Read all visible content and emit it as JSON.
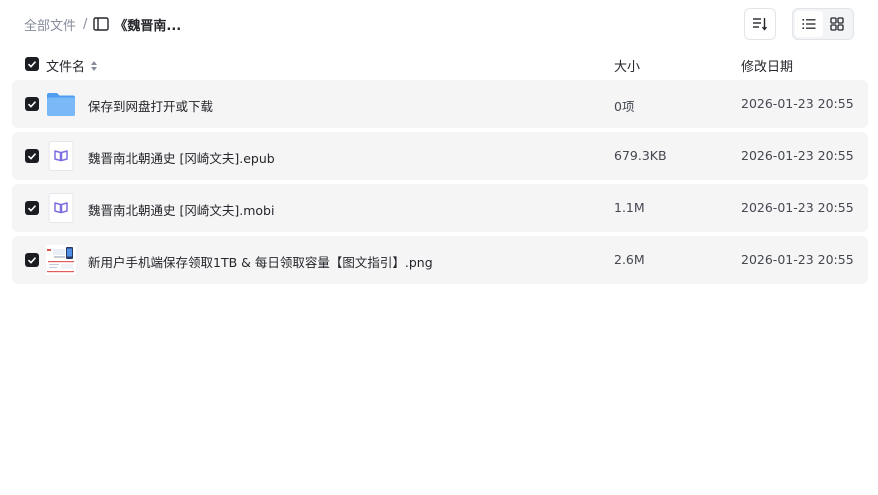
{
  "breadcrumb": {
    "root": "全部文件",
    "separator": "/",
    "current": "《魏晋南..."
  },
  "toolbar": {
    "sort_icon": "sort-icon",
    "list_view_icon": "list-view-icon",
    "grid_view_icon": "grid-view-icon"
  },
  "table": {
    "headers": {
      "name": "文件名",
      "size": "大小",
      "date": "修改日期"
    },
    "rows": [
      {
        "name": "保存到网盘打开或下载",
        "size": "0项",
        "date": "2026-01-23 20:55",
        "icon": "folder-icon"
      },
      {
        "name": "魏晋南北朝通史 [冈崎文夫].epub",
        "size": "679.3KB",
        "date": "2026-01-23 20:55",
        "icon": "ebook-file-icon"
      },
      {
        "name": "魏晋南北朝通史 [冈崎文夫].mobi",
        "size": "1.1M",
        "date": "2026-01-23 20:55",
        "icon": "ebook-file-icon"
      },
      {
        "name": "新用户手机端保存领取1TB & 每日领取容量【图文指引】.png",
        "size": "2.6M",
        "date": "2026-01-23 20:55",
        "icon": "image-thumbnail"
      }
    ]
  },
  "colors": {
    "row_bg": "#f5f5f6",
    "checkbox": "#1c1d22",
    "folder": "#5aa8f5",
    "ebook_accent": "#7b6fe0"
  }
}
